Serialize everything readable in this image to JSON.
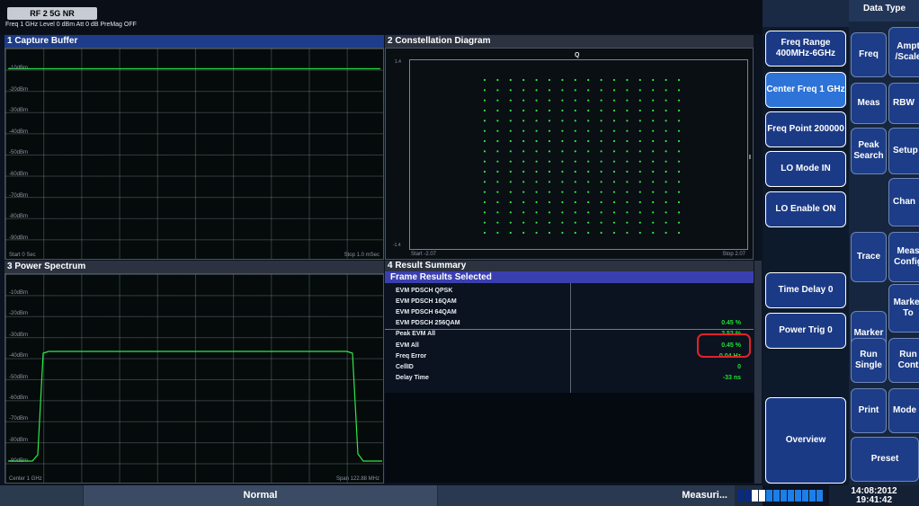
{
  "header": {
    "tab_label": "RF 2 5G NR",
    "settings_line": "Freq 1 GHz Level 0 dBm Att 0 dB PreMag OFF"
  },
  "panes": {
    "capture_buffer": {
      "title": "1 Capture Buffer",
      "y_labels": [
        "-10dBm",
        "-20dBm",
        "-30dBm",
        "-40dBm",
        "-50dBm",
        "-60dBm",
        "-70dBm",
        "-80dBm",
        "-90dBm"
      ],
      "footer_left": "Start 0 Sec",
      "footer_right": "Stop 1.0 mSec"
    },
    "constellation": {
      "title": "2 Constellation Diagram",
      "q_label": "Q",
      "i_label": "I",
      "y_top": "1.4",
      "y_bottom": "-1.4",
      "footer_left": "Start -2.07",
      "footer_right": "Stop 2.07"
    },
    "power_spectrum": {
      "title": "3 Power Spectrum",
      "y_labels": [
        "-10dBm",
        "-20dBm",
        "-30dBm",
        "-40dBm",
        "-50dBm",
        "-60dBm",
        "-70dBm",
        "-80dBm",
        "-90dBm"
      ],
      "footer_left": "Center 1 GHz",
      "footer_right": "Span 122.88 MHz"
    },
    "result_summary": {
      "title": "4 Result Summary",
      "header": "Frame Results Selected",
      "rows": [
        {
          "name": "EVM PDSCH QPSK",
          "value": ""
        },
        {
          "name": "EVM PDSCH 16QAM",
          "value": ""
        },
        {
          "name": "EVM PDSCH 64QAM",
          "value": ""
        },
        {
          "name": "EVM PDSCH 256QAM",
          "value": "0.45 %"
        },
        {
          "name": "Peak EVM All",
          "value": "2.52 %"
        },
        {
          "name": "EVM All",
          "value": "0.45 %"
        },
        {
          "name": "Freq Error",
          "value": "0.04 Hz"
        },
        {
          "name": "CellID",
          "value": "0"
        },
        {
          "name": "Delay Time",
          "value": "-33 ns"
        }
      ]
    }
  },
  "softkeys": {
    "title": "Data Type",
    "items": [
      {
        "label": "Freq Range 400MHz-6GHz",
        "selected": false
      },
      {
        "label": "Center Freq 1 GHz",
        "selected": true
      },
      {
        "label": "Freq Point 200000",
        "selected": false
      },
      {
        "label": "LO Mode IN",
        "selected": false
      },
      {
        "label": "LO Enable ON",
        "selected": false
      },
      {
        "label": "Time Delay 0",
        "selected": false
      },
      {
        "label": "Power Trig 0",
        "selected": false
      },
      {
        "label": "Overview",
        "selected": false
      }
    ]
  },
  "hardkeys": {
    "left": [
      "Freq",
      "Meas",
      "Peak Search",
      "Trace",
      "Marker",
      "Run Single",
      "Print"
    ],
    "right": [
      "Ampt /Scale",
      "RBW",
      "Setup",
      "Chan",
      "Meas Config",
      "Marker To",
      "Run Cont",
      "Mode"
    ],
    "preset": "Preset"
  },
  "status": {
    "mode": "Normal",
    "measuring": "Measuri...",
    "progress": 0.35,
    "time": "14:08:2012",
    "time2": "19:41:42"
  },
  "colors": {
    "trace_green": "#2ee84a",
    "title_blue": "#1d3c89",
    "highlight_red": "#e0232a"
  }
}
